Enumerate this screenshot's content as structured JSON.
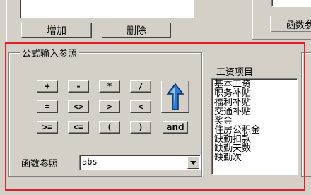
{
  "top": {
    "add_label": "增加",
    "delete_label": "删除",
    "right_button_label": "函数参"
  },
  "formula_panel": {
    "title": "公式输入参照",
    "operators": [
      "+",
      "-",
      "*",
      "/",
      "=",
      "<>",
      ">",
      "<",
      ">=",
      "<=",
      "(",
      ")",
      "and"
    ],
    "function_label": "函数参照",
    "function_value": "abs"
  },
  "salary_items": {
    "title": "工资项目",
    "items": [
      "基本工资",
      "职务补贴",
      "福利补贴",
      "交通补贴",
      "奖金",
      "住房公积金",
      "缺勤扣款",
      "缺勤天数",
      "缺勤次"
    ]
  },
  "colors": {
    "highlight_frame": "#e41e26",
    "arrow_blue": "#2a7ad4"
  }
}
